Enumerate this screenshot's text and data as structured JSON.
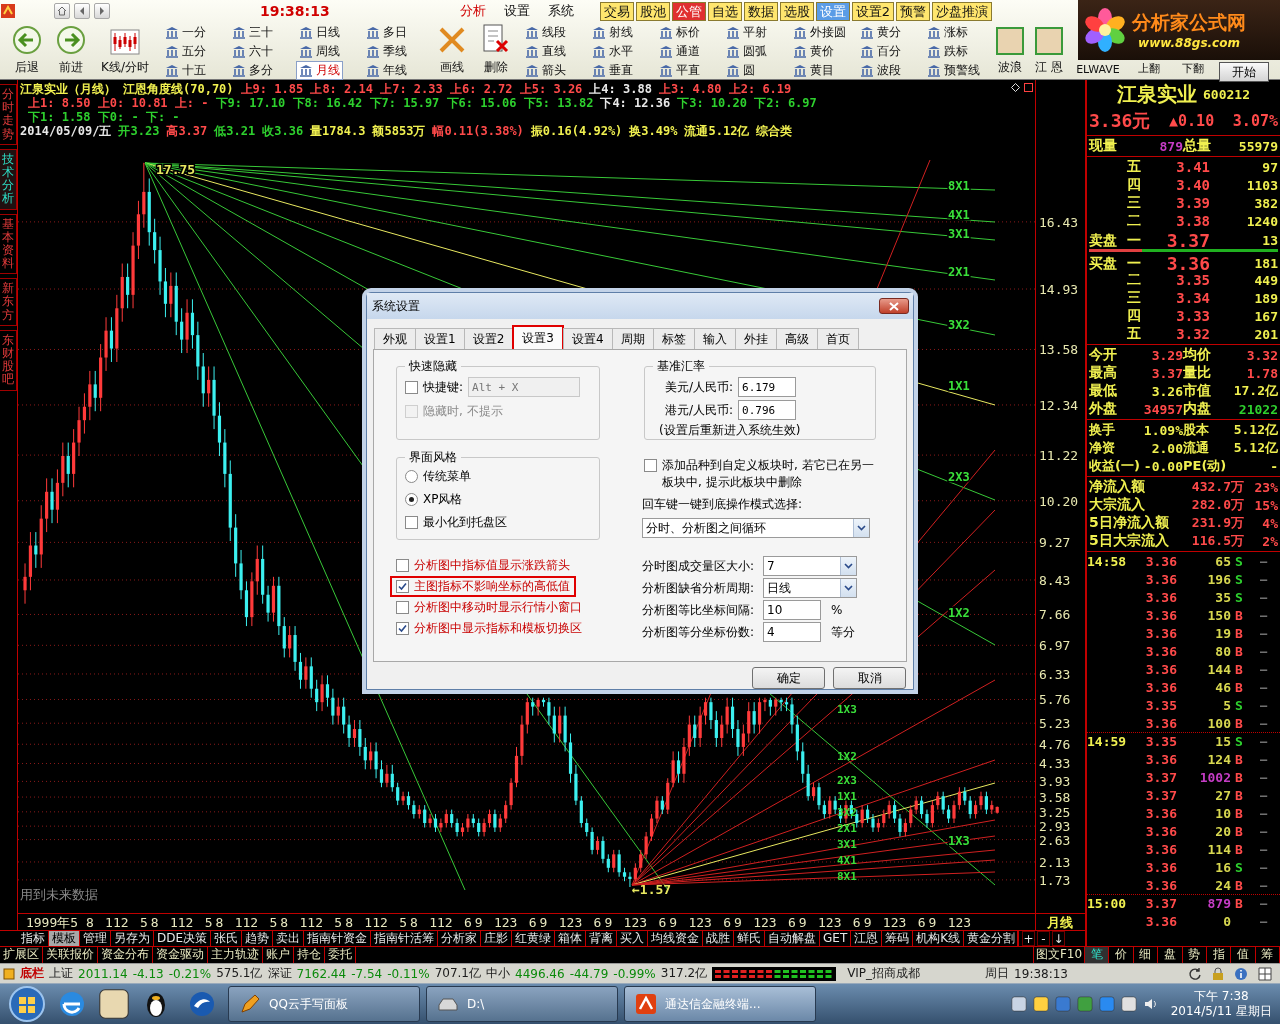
{
  "top_bar": {
    "clock": "19:38:13",
    "menus": [
      {
        "label": "分析",
        "selected": true
      },
      {
        "label": "设置",
        "selected": false
      },
      {
        "label": "系统",
        "selected": false
      }
    ],
    "quick_buttons": [
      {
        "label": "交易",
        "selected": false,
        "hot": false
      },
      {
        "label": "股池",
        "selected": false,
        "hot": false
      },
      {
        "label": "公管",
        "selected": false,
        "hot": true
      },
      {
        "label": "自选",
        "selected": false,
        "hot": false
      },
      {
        "label": "数据",
        "selected": false,
        "hot": false
      },
      {
        "label": "选股",
        "selected": false,
        "hot": false
      },
      {
        "label": "设置",
        "selected": true,
        "hot": false
      },
      {
        "label": "设置2",
        "selected": false,
        "hot": false
      },
      {
        "label": "预警",
        "selected": false,
        "hot": false
      },
      {
        "label": "沙盘推演",
        "selected": false,
        "hot": false
      }
    ],
    "logo": {
      "name": "分析家公式网",
      "url": "www.88gs.com"
    }
  },
  "toolbar": {
    "nav": [
      {
        "label": "后退",
        "kind": "back"
      },
      {
        "label": "前进",
        "kind": "forward"
      },
      {
        "label": "K线/分时",
        "kind": "kline"
      }
    ],
    "periods": [
      {
        "label": "一分",
        "selected": false
      },
      {
        "label": "三十",
        "selected": false
      },
      {
        "label": "日线",
        "selected": false
      },
      {
        "label": "多日",
        "selected": false
      },
      {
        "label": "五分",
        "selected": false
      },
      {
        "label": "六十",
        "selected": false
      },
      {
        "label": "周线",
        "selected": false
      },
      {
        "label": "季线",
        "selected": false
      },
      {
        "label": "十五",
        "selected": false
      },
      {
        "label": "多分",
        "selected": false
      },
      {
        "label": "月线",
        "selected": true
      },
      {
        "label": "年线",
        "selected": false
      }
    ],
    "edit_tools": [
      {
        "label": "画线",
        "kind": "pencil"
      },
      {
        "label": "删除",
        "kind": "delete"
      }
    ],
    "draw_tools": [
      "线段",
      "射线",
      "标价",
      "平射",
      "外接圆",
      "黄分",
      "涨标",
      "直线",
      "水平",
      "通道",
      "圆弧",
      "黄价",
      "百分",
      "跌标",
      "箭头",
      "垂直",
      "平直",
      "圆",
      "黄目",
      "波段",
      "预警线"
    ],
    "extras": [
      {
        "label": "波浪",
        "kind": "avatar"
      },
      {
        "label": "江 恩",
        "kind": "avatar"
      },
      {
        "label": "ELWAVE",
        "kind": "text"
      },
      {
        "label": "上翻",
        "kind": "text"
      },
      {
        "label": "下翻",
        "kind": "text"
      }
    ],
    "start_button": "开始"
  },
  "side_tabs": [
    {
      "label": "分时走势",
      "selected": false
    },
    {
      "label": "技术分析",
      "selected": true
    },
    {
      "label": "基本资料",
      "selected": false
    },
    {
      "label": "新东方",
      "selected": false
    },
    {
      "label": "东财股吧",
      "selected": false
    }
  ],
  "chart": {
    "header": [
      [
        {
          "text": "江泉实业（月线）",
          "kind": "flat"
        },
        {
          "text": "江恩角度线(70,70)",
          "kind": "flat"
        },
        {
          "text": "上9: 1.85 上8: 2.14 上7: 2.33 上6: 2.72 上5: 3.26",
          "kind": "up"
        },
        {
          "text": "上4: 3.88",
          "kind": "neutral"
        },
        {
          "text": "上3: 4.80 上2: 6.19",
          "kind": "up"
        }
      ],
      [
        {
          "text": "上1: 8.50 上0: 10.81 上: -",
          "kind": "up"
        },
        {
          "text": "下9: 17.10 下8: 16.42 下7: 15.97 下6: 15.06 下5: 13.82",
          "kind": "down"
        },
        {
          "text": "下4: 12.36",
          "kind": "neutral"
        },
        {
          "text": "下3: 10.20 下2: 6.97",
          "kind": "down"
        }
      ],
      [
        {
          "text": "下1: 1.58 下0: - 下: -",
          "kind": "down"
        }
      ],
      [
        {
          "text": "2014/05/09/五",
          "kind": "neutral"
        },
        {
          "text": "开3.23",
          "kind": "down"
        },
        {
          "text": "高3.37",
          "kind": "up"
        },
        {
          "text": "低3.21",
          "kind": "down"
        },
        {
          "text": "收3.36",
          "kind": "down"
        },
        {
          "text": "量1784.3",
          "kind": "flat"
        },
        {
          "text": "额5853万",
          "kind": "flat"
        },
        {
          "text": "幅0.11(3.38%)",
          "kind": "up"
        },
        {
          "text": "振0.16(4.92%)",
          "kind": "flat"
        },
        {
          "text": "换3.49%",
          "kind": "flat"
        },
        {
          "text": "流通5.12亿",
          "kind": "flat"
        },
        {
          "text": "综合类",
          "kind": "flat"
        }
      ]
    ],
    "chart_data": {
      "type": "candlestick",
      "categories": [
        null,
        null,
        null,
        null,
        null,
        "1999年5",
        null,
        null,
        null,
        null,
        null,
        null,
        "8",
        null,
        null,
        null,
        null,
        "112",
        null,
        null,
        null,
        null,
        "5",
        null,
        "8",
        null,
        null,
        null,
        null,
        "112",
        null,
        null,
        null,
        null,
        "5",
        null,
        "8",
        null,
        null,
        null,
        null,
        "112",
        null,
        null,
        null,
        null,
        "5",
        null,
        "8",
        null,
        null,
        null,
        null,
        "112",
        null,
        null,
        null,
        null,
        "5",
        null,
        "8",
        null,
        null,
        null,
        null,
        "112",
        null,
        null,
        null,
        null,
        "5",
        null,
        "8",
        null,
        null,
        null,
        null,
        "112",
        null,
        null,
        null,
        null,
        "6",
        null,
        "9",
        null,
        null,
        null,
        null,
        "123",
        null,
        null,
        null,
        null,
        "6",
        null,
        "9",
        null,
        null,
        null,
        null,
        "123",
        null,
        null,
        null,
        null,
        "6",
        null,
        "9",
        null,
        null,
        null,
        null,
        "123",
        null,
        null,
        null,
        null,
        "6",
        null,
        "9",
        null,
        null,
        null,
        null,
        "123",
        null,
        null,
        null,
        null,
        "6",
        null,
        "9",
        null,
        null,
        null,
        null,
        "123",
        null,
        null,
        null,
        null,
        "6",
        null,
        "9",
        null,
        null,
        null,
        null,
        "123",
        null,
        null,
        null,
        null,
        "6",
        null,
        "9",
        null,
        null,
        null,
        null,
        "123",
        null,
        null,
        null,
        null,
        "6",
        null,
        "9",
        null,
        null,
        null,
        null,
        "123",
        null,
        null,
        null,
        null,
        null,
        null,
        null
      ],
      "ylim": [
        0.61,
        19.6
      ],
      "grid": true,
      "ohlc": [
        [
          8.2,
          8.8,
          7.9,
          8.5
        ],
        [
          8.5,
          9.5,
          8.2,
          9.2
        ],
        [
          9.2,
          9.5,
          8.7,
          9.0
        ],
        [
          9.0,
          10.1,
          8.7,
          9.8
        ],
        [
          9.8,
          10.7,
          9.5,
          10.4
        ],
        [
          10.4,
          10.7,
          9.7,
          10.0
        ],
        [
          10.0,
          10.9,
          9.7,
          10.6
        ],
        [
          10.6,
          11.5,
          10.3,
          11.2
        ],
        [
          11.2,
          11.5,
          10.5,
          10.8
        ],
        [
          10.8,
          11.8,
          10.5,
          11.5
        ],
        [
          11.5,
          12.3,
          11.2,
          12.0
        ],
        [
          12.0,
          12.6,
          11.7,
          12.3
        ],
        [
          12.3,
          13.1,
          12.0,
          12.8
        ],
        [
          12.8,
          13.1,
          12.2,
          12.5
        ],
        [
          12.5,
          13.7,
          12.2,
          13.4
        ],
        [
          13.4,
          14.3,
          13.1,
          14.0
        ],
        [
          14.0,
          14.3,
          13.3,
          13.6
        ],
        [
          13.6,
          14.8,
          13.3,
          14.5
        ],
        [
          14.5,
          15.5,
          14.2,
          15.2
        ],
        [
          15.2,
          15.5,
          14.5,
          14.8
        ],
        [
          14.8,
          16.2,
          14.5,
          15.9
        ],
        [
          15.9,
          16.9,
          15.6,
          16.6
        ],
        [
          16.6,
          17.75,
          16.3,
          17.1
        ],
        [
          17.1,
          17.4,
          15.9,
          16.2
        ],
        [
          16.2,
          16.5,
          15.5,
          15.8
        ],
        [
          15.8,
          16.1,
          14.8,
          15.1
        ],
        [
          15.1,
          15.4,
          14.3,
          14.6
        ],
        [
          14.6,
          15.3,
          14.3,
          15.0
        ],
        [
          15.0,
          15.3,
          13.9,
          14.2
        ],
        [
          14.2,
          14.5,
          13.5,
          13.8
        ],
        [
          13.8,
          14.7,
          13.5,
          14.4
        ],
        [
          14.4,
          14.7,
          13.6,
          13.9
        ],
        [
          13.9,
          14.2,
          12.9,
          13.2
        ],
        [
          13.2,
          13.5,
          12.3,
          12.6
        ],
        [
          12.6,
          13.2,
          12.3,
          12.9
        ],
        [
          12.9,
          13.2,
          11.8,
          12.1
        ],
        [
          12.1,
          12.4,
          11.2,
          11.5
        ],
        [
          11.5,
          11.8,
          10.5,
          10.8
        ],
        [
          10.8,
          11.1,
          9.3,
          9.6
        ],
        [
          9.6,
          9.9,
          8.5,
          8.8
        ],
        [
          8.8,
          9.1,
          8.0,
          8.2
        ],
        [
          8.2,
          8.4,
          7.4,
          7.6
        ],
        [
          7.6,
          8.6,
          7.4,
          8.4
        ],
        [
          8.4,
          9.2,
          8.1,
          8.9
        ],
        [
          8.9,
          9.2,
          7.9,
          8.1
        ],
        [
          8.1,
          8.3,
          7.5,
          7.7
        ],
        [
          7.7,
          8.5,
          7.5,
          8.3
        ],
        [
          8.3,
          8.5,
          7.2,
          7.4
        ],
        [
          7.4,
          7.6,
          6.7,
          6.9
        ],
        [
          6.9,
          7.4,
          6.7,
          7.2
        ],
        [
          7.2,
          7.4,
          6.4,
          6.6
        ],
        [
          6.6,
          6.8,
          6.0,
          6.2
        ],
        [
          6.2,
          6.7,
          6.0,
          6.5
        ],
        [
          6.5,
          6.7,
          5.8,
          6.0
        ],
        [
          6.0,
          6.2,
          5.5,
          5.7
        ],
        [
          5.7,
          6.3,
          5.5,
          6.1
        ],
        [
          6.1,
          6.3,
          5.6,
          5.8
        ],
        [
          5.8,
          6.0,
          5.2,
          5.4
        ],
        [
          5.4,
          5.8,
          5.2,
          5.6
        ],
        [
          5.6,
          5.8,
          5.0,
          5.2
        ],
        [
          5.2,
          5.4,
          4.7,
          4.9
        ],
        [
          4.9,
          5.3,
          4.7,
          5.1
        ],
        [
          5.1,
          5.3,
          4.5,
          4.7
        ],
        [
          4.7,
          4.9,
          4.2,
          4.4
        ],
        [
          4.4,
          4.8,
          4.2,
          4.6
        ],
        [
          4.6,
          4.8,
          4.0,
          4.2
        ],
        [
          4.2,
          4.4,
          3.8,
          3.9
        ],
        [
          3.9,
          4.3,
          3.8,
          4.1
        ],
        [
          4.1,
          4.3,
          3.7,
          3.8
        ],
        [
          3.8,
          3.9,
          3.4,
          3.5
        ],
        [
          3.5,
          3.7,
          3.4,
          3.6
        ],
        [
          3.6,
          3.7,
          3.3,
          3.4
        ],
        [
          3.4,
          3.5,
          3.1,
          3.2
        ],
        [
          3.2,
          3.4,
          3.1,
          3.3
        ],
        [
          3.3,
          3.4,
          2.9,
          3.0
        ],
        [
          3.0,
          3.2,
          2.9,
          3.1
        ],
        [
          3.1,
          3.2,
          2.8,
          2.9
        ],
        [
          2.9,
          3.1,
          2.8,
          3.0
        ],
        [
          3.0,
          3.3,
          2.9,
          3.2
        ],
        [
          3.2,
          3.3,
          2.9,
          3.0
        ],
        [
          3.0,
          3.1,
          2.7,
          2.8
        ],
        [
          2.8,
          3.0,
          2.7,
          2.9
        ],
        [
          2.9,
          3.2,
          2.8,
          3.1
        ],
        [
          3.1,
          3.2,
          2.9,
          3.0
        ],
        [
          3.0,
          3.1,
          2.7,
          2.8
        ],
        [
          2.8,
          3.1,
          2.7,
          3.0
        ],
        [
          3.0,
          3.3,
          2.9,
          3.2
        ],
        [
          3.2,
          3.3,
          2.8,
          2.9
        ],
        [
          2.9,
          3.2,
          2.8,
          3.1
        ],
        [
          3.1,
          3.5,
          3.0,
          3.4
        ],
        [
          3.4,
          4.0,
          3.3,
          3.9
        ],
        [
          3.9,
          4.7,
          3.8,
          4.5
        ],
        [
          4.5,
          5.4,
          4.3,
          5.2
        ],
        [
          5.2,
          5.8,
          5.0,
          5.7
        ],
        [
          5.7,
          5.8,
          5.4,
          5.6
        ],
        [
          5.6,
          5.8,
          5.4,
          5.75
        ],
        [
          5.75,
          5.8,
          5.6,
          5.7
        ],
        [
          5.7,
          5.8,
          5.2,
          5.4
        ],
        [
          5.4,
          5.6,
          4.8,
          5.0
        ],
        [
          5.0,
          5.6,
          4.8,
          5.4
        ],
        [
          5.4,
          5.6,
          4.6,
          4.8
        ],
        [
          4.8,
          5.0,
          3.9,
          4.1
        ],
        [
          4.1,
          4.3,
          3.4,
          3.5
        ],
        [
          3.5,
          3.6,
          2.9,
          3.0
        ],
        [
          3.0,
          3.1,
          2.7,
          2.8
        ],
        [
          2.8,
          2.9,
          2.3,
          2.4
        ],
        [
          2.4,
          2.7,
          2.3,
          2.6
        ],
        [
          2.6,
          2.7,
          2.1,
          2.2
        ],
        [
          2.2,
          2.3,
          1.9,
          2.0
        ],
        [
          2.0,
          2.4,
          1.9,
          2.3
        ],
        [
          2.3,
          2.4,
          1.8,
          1.9
        ],
        [
          1.9,
          2.0,
          1.7,
          1.8
        ],
        [
          1.8,
          1.9,
          1.57,
          1.75
        ],
        [
          1.75,
          2.1,
          1.7,
          2.0
        ],
        [
          2.0,
          2.4,
          1.9,
          2.3
        ],
        [
          2.3,
          2.8,
          2.2,
          2.7
        ],
        [
          2.7,
          3.2,
          2.6,
          3.1
        ],
        [
          3.1,
          3.6,
          3.0,
          3.5
        ],
        [
          3.5,
          3.6,
          3.2,
          3.3
        ],
        [
          3.3,
          4.0,
          3.2,
          3.9
        ],
        [
          3.9,
          4.6,
          3.8,
          4.4
        ],
        [
          4.4,
          4.6,
          3.9,
          4.1
        ],
        [
          4.1,
          4.9,
          3.9,
          4.7
        ],
        [
          4.7,
          5.4,
          4.5,
          5.2
        ],
        [
          5.2,
          5.4,
          4.7,
          4.9
        ],
        [
          4.9,
          5.6,
          4.7,
          5.4
        ],
        [
          5.4,
          5.8,
          5.2,
          5.7
        ],
        [
          5.7,
          5.8,
          5.1,
          5.3
        ],
        [
          5.3,
          5.5,
          4.7,
          4.9
        ],
        [
          4.9,
          5.4,
          4.7,
          5.2
        ],
        [
          5.2,
          5.8,
          5.0,
          5.6
        ],
        [
          5.6,
          5.8,
          4.9,
          5.1
        ],
        [
          5.1,
          5.3,
          4.5,
          4.7
        ],
        [
          4.7,
          5.2,
          4.5,
          5.0
        ],
        [
          5.0,
          5.7,
          4.8,
          5.5
        ],
        [
          5.5,
          5.7,
          5.0,
          5.2
        ],
        [
          5.2,
          5.8,
          5.0,
          5.7
        ],
        [
          5.7,
          5.8,
          5.5,
          5.75
        ],
        [
          5.75,
          5.8,
          5.4,
          5.6
        ],
        [
          5.6,
          5.8,
          5.4,
          5.75
        ],
        [
          5.75,
          5.8,
          5.5,
          5.7
        ],
        [
          5.7,
          5.8,
          5.5,
          5.65
        ],
        [
          5.65,
          5.8,
          5.0,
          5.2
        ],
        [
          5.2,
          5.4,
          4.4,
          4.6
        ],
        [
          4.6,
          4.8,
          3.9,
          4.1
        ],
        [
          4.1,
          4.3,
          3.5,
          3.6
        ],
        [
          3.6,
          3.9,
          3.5,
          3.8
        ],
        [
          3.8,
          3.9,
          3.3,
          3.4
        ],
        [
          3.4,
          3.5,
          3.1,
          3.2
        ],
        [
          3.2,
          3.6,
          3.1,
          3.5
        ],
        [
          3.5,
          3.6,
          3.2,
          3.3
        ],
        [
          3.3,
          3.4,
          3.0,
          3.1
        ],
        [
          3.1,
          3.5,
          3.0,
          3.4
        ],
        [
          3.4,
          3.5,
          3.1,
          3.2
        ],
        [
          3.2,
          3.3,
          2.9,
          3.0
        ],
        [
          3.0,
          3.4,
          2.9,
          3.3
        ],
        [
          3.3,
          3.4,
          3.0,
          3.1
        ],
        [
          3.1,
          3.2,
          2.8,
          2.9
        ],
        [
          2.9,
          3.1,
          2.8,
          3.0
        ],
        [
          3.0,
          3.3,
          2.9,
          3.2
        ],
        [
          3.2,
          3.5,
          3.1,
          3.4
        ],
        [
          3.4,
          3.5,
          3.0,
          3.1
        ],
        [
          3.1,
          3.2,
          2.7,
          2.8
        ],
        [
          2.8,
          3.1,
          2.7,
          3.0
        ],
        [
          3.0,
          3.4,
          2.9,
          3.3
        ],
        [
          3.3,
          3.6,
          3.2,
          3.5
        ],
        [
          3.5,
          3.6,
          3.1,
          3.2
        ],
        [
          3.2,
          3.3,
          2.9,
          3.0
        ],
        [
          3.0,
          3.5,
          2.9,
          3.4
        ],
        [
          3.4,
          3.7,
          3.3,
          3.6
        ],
        [
          3.6,
          3.7,
          3.2,
          3.3
        ],
        [
          3.3,
          3.4,
          3.0,
          3.1
        ],
        [
          3.1,
          3.5,
          3.0,
          3.4
        ],
        [
          3.4,
          3.8,
          3.3,
          3.7
        ],
        [
          3.7,
          3.8,
          3.4,
          3.5
        ],
        [
          3.5,
          3.6,
          3.1,
          3.2
        ],
        [
          3.2,
          3.5,
          3.1,
          3.4
        ],
        [
          3.4,
          3.7,
          3.3,
          3.6
        ],
        [
          3.6,
          3.7,
          3.2,
          3.3
        ],
        [
          3.3,
          3.5,
          3.2,
          3.4
        ],
        [
          3.23,
          3.37,
          3.21,
          3.36
        ]
      ],
      "yticks": [
        {
          "value": 16.43,
          "label": "16.43"
        },
        {
          "value": 14.93,
          "label": "14.93"
        },
        {
          "value": 13.58,
          "label": "13.58"
        },
        {
          "value": 12.34,
          "label": "12.34"
        },
        {
          "value": 11.22,
          "label": "11.22"
        },
        {
          "value": 10.2,
          "label": "10.20"
        },
        {
          "value": 9.27,
          "label": "9.27"
        },
        {
          "value": 8.43,
          "label": "8.43"
        },
        {
          "value": 7.66,
          "label": "7.66"
        },
        {
          "value": 6.97,
          "label": "6.97"
        },
        {
          "value": 6.33,
          "label": "6.33"
        },
        {
          "value": 5.76,
          "label": "5.76"
        },
        {
          "value": 5.23,
          "label": "5.23"
        },
        {
          "value": 4.76,
          "label": "4.76"
        },
        {
          "value": 4.33,
          "label": "4.33"
        },
        {
          "value": 3.93,
          "label": "3.93"
        },
        {
          "value": 3.58,
          "label": "3.58"
        },
        {
          "value": 3.25,
          "label": "3.25"
        },
        {
          "value": 2.93,
          "label": "2.93"
        },
        {
          "value": 2.63,
          "label": "2.63"
        },
        {
          "value": 2.13,
          "label": "2.13"
        },
        {
          "value": 1.73,
          "label": "1.73"
        }
      ]
    },
    "fan_upper": [
      "8X1",
      "4X1",
      "3X1",
      "2X1",
      "3X2",
      "1X1",
      "2X3",
      "1X2",
      "1X3"
    ],
    "fan_lower": [
      "1X3",
      "1X2",
      "2X3",
      "1X1",
      "3X2",
      "2X1",
      "3X1",
      "4X1",
      "8X1"
    ],
    "high_label": "17.75",
    "low_label": "←1.57",
    "note": "用到未来数据",
    "period_label": "月线"
  },
  "dialog": {
    "title": "系统设置",
    "tabs": [
      {
        "label": "外观",
        "selected": false,
        "highlighted": false
      },
      {
        "label": "设置1",
        "selected": false,
        "highlighted": false
      },
      {
        "label": "设置2",
        "selected": false,
        "highlighted": false
      },
      {
        "label": "设置3",
        "selected": true,
        "highlighted": true
      },
      {
        "label": "设置4",
        "selected": false,
        "highlighted": false
      },
      {
        "label": "周期",
        "selected": false,
        "highlighted": false
      },
      {
        "label": "标签",
        "selected": false,
        "highlighted": false
      },
      {
        "label": "输入",
        "selected": false,
        "highlighted": false
      },
      {
        "label": "外挂",
        "selected": false,
        "highlighted": false
      },
      {
        "label": "高级",
        "selected": false,
        "highlighted": false
      },
      {
        "label": "首页",
        "selected": false,
        "highlighted": false
      }
    ],
    "quick_hide": {
      "legend": "快速隐藏",
      "hotkey_label": "快捷键:",
      "hotkey_checked": false,
      "hotkey_value": "Alt + X",
      "silent_label": "隐藏时, 不提示",
      "silent_checked": false,
      "silent_disabled": true
    },
    "rates": {
      "legend": "基准汇率",
      "rows": [
        {
          "label": "美元/人民币:",
          "value": "6.179"
        },
        {
          "label": "港元/人民币:",
          "value": "0.796"
        }
      ],
      "note": "(设置后重新进入系统生效)"
    },
    "style": {
      "legend": "界面风格",
      "options": [
        {
          "label": "传统菜单",
          "selected": false
        },
        {
          "label": "XP风格",
          "selected": true
        }
      ],
      "tray_label": "最小化到托盘区",
      "tray_checked": false
    },
    "add_prompt": {
      "label": "添加品种到自定义板块时, 若它已在另一板块中, 提示此板块中删除",
      "checked": false
    },
    "enter_mode": {
      "label": "回车键一键到底操作模式选择:",
      "value": "分时、分析图之间循环"
    },
    "options": [
      {
        "label": "分析图中指标值显示涨跌箭头",
        "checked": false,
        "highlighted": false
      },
      {
        "label": "主图指标不影响坐标的高低值",
        "checked": true,
        "highlighted": true
      },
      {
        "label": "分析图中移动时显示行情小窗口",
        "checked": false,
        "highlighted": false
      },
      {
        "label": "分析图中显示指标和模板切换区",
        "checked": true,
        "highlighted": false
      }
    ],
    "fields": [
      {
        "label": "分时图成交量区大小:",
        "value": "7",
        "kind": "select"
      },
      {
        "label": "分析图缺省分析周期:",
        "value": "日线",
        "kind": "select"
      },
      {
        "label": "分析图等比坐标间隔:",
        "value": "10",
        "kind": "input",
        "unit": "%"
      },
      {
        "label": "分析图等分坐标份数:",
        "value": "4",
        "kind": "input",
        "unit": "等分"
      }
    ],
    "buttons": [
      "确定",
      "取消"
    ]
  },
  "quote": {
    "name": "江泉实业",
    "code": "600212",
    "price": "3.36元",
    "change": "▲0.10",
    "pct": "3.07%",
    "volume": [
      {
        "label": "现量",
        "value": "879",
        "kind": "big"
      },
      {
        "label": "总量",
        "value": "55979",
        "kind": "flat"
      }
    ],
    "asks": [
      {
        "level": "五",
        "price": "3.41",
        "volume": "97"
      },
      {
        "level": "四",
        "price": "3.40",
        "volume": "1103"
      },
      {
        "level": "三",
        "price": "3.39",
        "volume": "382"
      },
      {
        "level": "二",
        "price": "3.38",
        "volume": "1240"
      },
      {
        "side": "卖盘",
        "level": "一",
        "price": "3.37",
        "volume": "13"
      }
    ],
    "bids": [
      {
        "side": "买盘",
        "level": "一",
        "price": "3.36",
        "volume": "181"
      },
      {
        "level": "二",
        "price": "3.35",
        "volume": "449"
      },
      {
        "level": "三",
        "price": "3.34",
        "volume": "189"
      },
      {
        "level": "四",
        "price": "3.33",
        "volume": "167"
      },
      {
        "level": "五",
        "price": "3.32",
        "volume": "201"
      }
    ],
    "stats": [
      [
        {
          "label": "今开",
          "value": "3.29",
          "kind": "up"
        },
        {
          "label": "均价",
          "value": "3.32",
          "kind": "up"
        }
      ],
      [
        {
          "label": "最高",
          "value": "3.37",
          "kind": "up"
        },
        {
          "label": "量比",
          "value": "1.78",
          "kind": "up"
        }
      ],
      [
        {
          "label": "最低",
          "value": "3.26",
          "kind": "flat"
        },
        {
          "label": "市值",
          "value": "17.2亿",
          "kind": "flat"
        }
      ],
      [
        {
          "label": "外盘",
          "value": "34957",
          "kind": "up"
        },
        {
          "label": "内盘",
          "value": "21022",
          "kind": "down"
        }
      ]
    ],
    "fundamentals": [
      [
        {
          "label": "换手",
          "value": "1.09%"
        },
        {
          "label": "股本",
          "value": "5.12亿"
        }
      ],
      [
        {
          "label": "净资",
          "value": "2.00"
        },
        {
          "label": "流通",
          "value": "5.12亿"
        }
      ],
      [
        {
          "label": "收益(一)",
          "value": "-0.00"
        },
        {
          "label": "PE(动)",
          "value": "-"
        }
      ]
    ],
    "flows": [
      {
        "label": "净流入额",
        "amount": "432.7万",
        "pct": "23%"
      },
      {
        "label": "大宗流入",
        "amount": "282.0万",
        "pct": "15%"
      },
      {
        "label": "5日净流入额",
        "amount": "231.9万",
        "pct": "4%"
      },
      {
        "label": "5日大宗流入",
        "amount": "116.5万",
        "pct": "2%"
      }
    ],
    "ticks": [
      {
        "time": "14:58",
        "price": "3.36",
        "volume": "65",
        "side": "S",
        "kind": "sell",
        "big": false,
        "flag": "—"
      },
      {
        "price": "3.36",
        "volume": "196",
        "side": "S",
        "kind": "sell",
        "big": false,
        "flag": "—"
      },
      {
        "price": "3.36",
        "volume": "35",
        "side": "S",
        "kind": "sell",
        "big": false,
        "flag": "—"
      },
      {
        "price": "3.36",
        "volume": "150",
        "side": "B",
        "kind": "buy",
        "big": false,
        "flag": "—"
      },
      {
        "price": "3.36",
        "volume": "19",
        "side": "B",
        "kind": "buy",
        "big": false,
        "flag": "—"
      },
      {
        "price": "3.36",
        "volume": "80",
        "side": "B",
        "kind": "buy",
        "big": false,
        "flag": "—"
      },
      {
        "price": "3.36",
        "volume": "144",
        "side": "B",
        "kind": "buy",
        "big": false,
        "flag": "—"
      },
      {
        "price": "3.36",
        "volume": "46",
        "side": "B",
        "kind": "buy",
        "big": false,
        "flag": "—"
      },
      {
        "price": "3.35",
        "volume": "5",
        "side": "S",
        "kind": "sell",
        "big": false,
        "flag": "—"
      },
      {
        "price": "3.36",
        "volume": "100",
        "side": "B",
        "kind": "buy",
        "big": false,
        "flag": "—"
      },
      {
        "time": "14:59",
        "price": "3.35",
        "volume": "15",
        "side": "S",
        "kind": "sell",
        "big": false,
        "flag": "—"
      },
      {
        "price": "3.36",
        "volume": "124",
        "side": "B",
        "kind": "buy",
        "big": false,
        "flag": "—"
      },
      {
        "price": "3.37",
        "volume": "1002",
        "side": "B",
        "kind": "buy",
        "big": true,
        "flag": "—"
      },
      {
        "price": "3.37",
        "volume": "27",
        "side": "B",
        "kind": "buy",
        "big": false,
        "flag": "—"
      },
      {
        "price": "3.36",
        "volume": "10",
        "side": "B",
        "kind": "buy",
        "big": false,
        "flag": "—"
      },
      {
        "price": "3.36",
        "volume": "20",
        "side": "B",
        "kind": "buy",
        "big": false,
        "flag": "—"
      },
      {
        "price": "3.36",
        "volume": "114",
        "side": "B",
        "kind": "buy",
        "big": false,
        "flag": "—"
      },
      {
        "price": "3.36",
        "volume": "16",
        "side": "S",
        "kind": "sell",
        "big": false,
        "flag": "—"
      },
      {
        "price": "3.36",
        "volume": "24",
        "side": "B",
        "kind": "buy",
        "big": false,
        "flag": "—"
      },
      {
        "time": "15:00",
        "price": "3.37",
        "volume": "879",
        "side": "B",
        "kind": "buy",
        "big": true,
        "flag": "—"
      },
      {
        "price": "3.36",
        "volume": "0",
        "kind": "none",
        "big": false,
        "flag": "—"
      }
    ]
  },
  "indicator_tabs": [
    {
      "label": "指标",
      "selected": false
    },
    {
      "label": "模板",
      "selected": true
    },
    {
      "label": "管理",
      "selected": false
    },
    {
      "label": "另存为",
      "selected": false
    },
    {
      "label": "DDE决策",
      "selected": false
    },
    {
      "label": "张氏",
      "selected": false
    },
    {
      "label": "趋势",
      "selected": false
    },
    {
      "label": "卖出",
      "selected": false
    },
    {
      "label": "指南针资金",
      "selected": false
    },
    {
      "label": "指南针活筹",
      "selected": false
    },
    {
      "label": "分析家",
      "selected": false
    },
    {
      "label": "庄影",
      "selected": false
    },
    {
      "label": "红黄绿",
      "selected": false
    },
    {
      "label": "箱体",
      "selected": false
    },
    {
      "label": "背离",
      "selected": false
    },
    {
      "label": "买入",
      "selected": false
    },
    {
      "label": "均线资金",
      "selected": false
    },
    {
      "label": "战胜",
      "selected": false
    },
    {
      "label": "鲜氏",
      "selected": false
    },
    {
      "label": "自动解盘",
      "selected": false
    },
    {
      "label": "GET",
      "selected": false
    },
    {
      "label": "江恩",
      "selected": false
    },
    {
      "label": "筹码",
      "selected": false
    },
    {
      "label": "机构K线",
      "selected": false
    },
    {
      "label": "黄金分割",
      "selected": false
    }
  ],
  "indicator_controls": [
    "+",
    "-",
    "↓"
  ],
  "bottom_tabs": [
    {
      "label": "扩展区",
      "selected": false
    },
    {
      "label": "关联报价",
      "selected": false
    },
    {
      "label": "资金分布",
      "selected": false
    },
    {
      "label": "资金驱动",
      "selected": false
    },
    {
      "label": "主力轨迹",
      "selected": false
    },
    {
      "label": "账户",
      "selected": false
    },
    {
      "label": "持仓",
      "selected": false
    },
    {
      "label": "委托",
      "selected": false
    }
  ],
  "f10_button": "图文F10",
  "detail_tabs": [
    {
      "label": "笔",
      "selected": true
    },
    {
      "label": "价",
      "selected": false
    },
    {
      "label": "细",
      "selected": false
    },
    {
      "label": "盘",
      "selected": false
    },
    {
      "label": "势",
      "selected": false
    },
    {
      "label": "指",
      "selected": false
    },
    {
      "label": "值",
      "selected": false
    },
    {
      "label": "筹",
      "selected": false
    }
  ],
  "status_bar": {
    "label": "底栏",
    "indices": [
      {
        "name": "上证",
        "value": "2011.14",
        "change": "-4.13",
        "pct": "-0.21%",
        "amount": "575.1亿",
        "kind": "down"
      },
      {
        "name": "深证",
        "value": "7162.44",
        "change": "-7.54",
        "pct": "-0.11%",
        "amount": "707.1亿",
        "kind": "down"
      },
      {
        "name": "中小",
        "value": "4496.46",
        "change": "-44.79",
        "pct": "-0.99%",
        "amount": "317.2亿",
        "kind": "down"
      }
    ],
    "account": "VIP_招商成都",
    "weekday": "周日",
    "time": "19:38:13"
  },
  "taskbar": {
    "tasks": [
      {
        "label": "QQ云手写面板",
        "kind": "pencil",
        "selected": false
      },
      {
        "label": "D:\\",
        "kind": "drive",
        "selected": false
      },
      {
        "label": "通达信金融终端...",
        "kind": "app",
        "selected": true
      }
    ],
    "clock_time": "下午 7:38",
    "clock_date": "2014/5/11 星期日"
  }
}
